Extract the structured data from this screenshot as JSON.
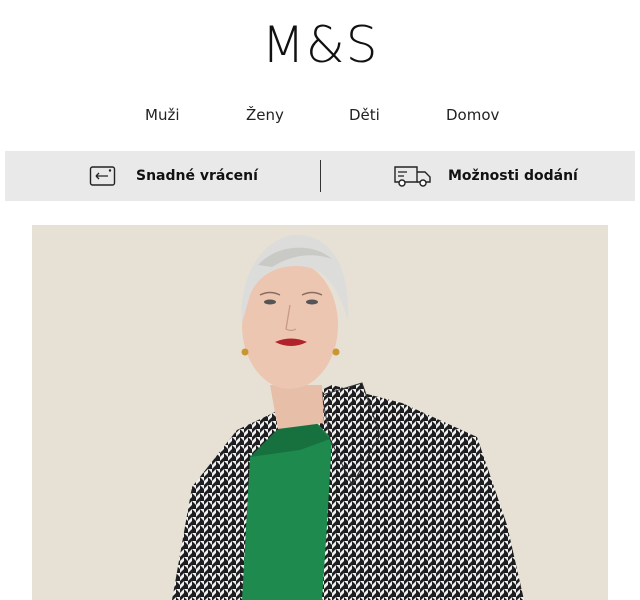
{
  "brand": {
    "logo": "M&S"
  },
  "nav": {
    "items": [
      "Muži",
      "Ženy",
      "Děti",
      "Domov"
    ]
  },
  "service_bar": {
    "returns_label": "Snadné vrácení",
    "returns_icon": "return-tag-icon",
    "delivery_label": "Možnosti dodání",
    "delivery_icon": "delivery-truck-icon"
  },
  "hero": {
    "image": "woman-in-houndstooth-coat-photo",
    "colors": {
      "background": "#e6e0d5",
      "sweater": "#1f8a4e",
      "coat_dark": "#1d1d1f",
      "coat_light": "#f2f2f2"
    }
  }
}
